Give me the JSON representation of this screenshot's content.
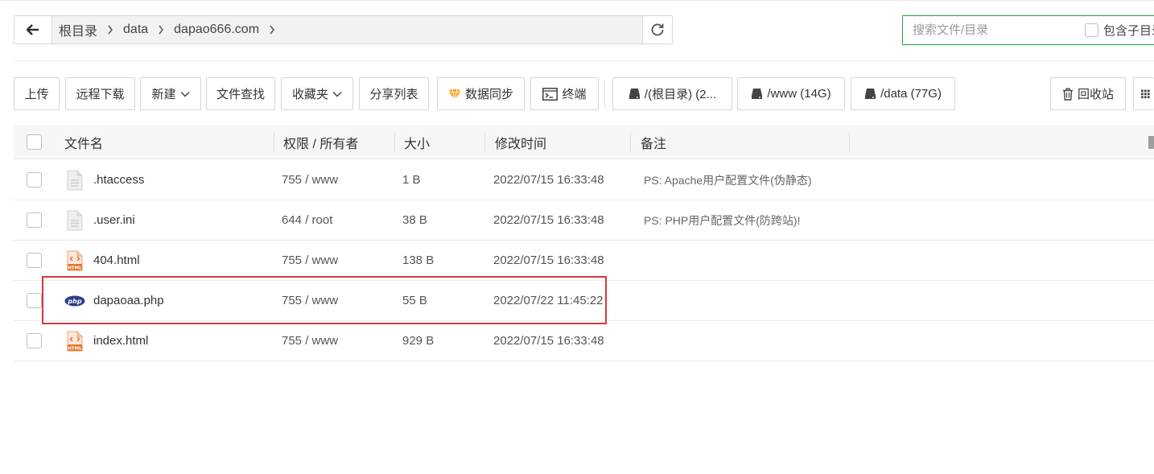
{
  "breadcrumb": {
    "items": [
      "根目录",
      "data",
      "dapao666.com"
    ]
  },
  "search": {
    "placeholder": "搜索文件/目录",
    "subdir_label": "包含子目录"
  },
  "toolbar": {
    "upload": "上传",
    "remote_download": "远程下载",
    "new": "新建",
    "file_search": "文件查找",
    "favorites": "收藏夹",
    "share_list": "分享列表",
    "data_sync": "数据同步",
    "terminal": "终端",
    "disk_root": "/(根目录) (2...",
    "disk_www": "/www (14G)",
    "disk_data": "/data (77G)",
    "recycle_bin": "回收站"
  },
  "table": {
    "headers": {
      "name": "文件名",
      "perm": "权限 / 所有者",
      "size": "大小",
      "mtime": "修改时间",
      "remark": "备注"
    },
    "rows": [
      {
        "name": ".htaccess",
        "perm": "755 / www",
        "size": "1 B",
        "mtime": "2022/07/15 16:33:48",
        "remark": "PS: Apache用户配置文件(伪静态)",
        "icon": "generic-file-icon"
      },
      {
        "name": ".user.ini",
        "perm": "644 / root",
        "size": "38 B",
        "mtime": "2022/07/15 16:33:48",
        "remark": "PS: PHP用户配置文件(防跨站)!",
        "icon": "generic-file-icon"
      },
      {
        "name": "404.html",
        "perm": "755 / www",
        "size": "138 B",
        "mtime": "2022/07/15 16:33:48",
        "remark": "",
        "icon": "html-file-icon"
      },
      {
        "name": "dapaoaa.php",
        "perm": "755 / www",
        "size": "55 B",
        "mtime": "2022/07/22 11:45:22",
        "remark": "",
        "icon": "php-file-icon"
      },
      {
        "name": "index.html",
        "perm": "755 / www",
        "size": "929 B",
        "mtime": "2022/07/15 16:33:48",
        "remark": "",
        "icon": "html-file-icon"
      }
    ]
  },
  "colors": {
    "accent_green": "#20a53a",
    "highlight_red": "#d9363e",
    "php_blue": "#2c3e8c",
    "html_orange": "#e8742b"
  }
}
